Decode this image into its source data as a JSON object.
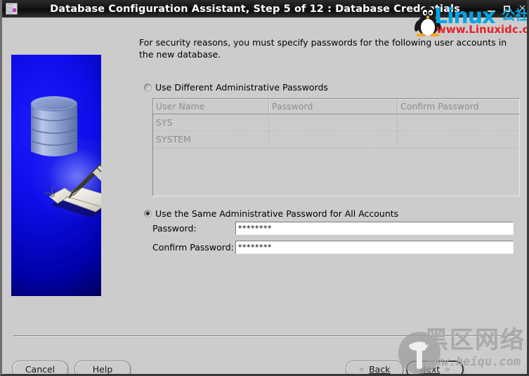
{
  "window": {
    "title": "Database Configuration Assistant, Step 5 of 12 : Database Credentials",
    "icon": "database-assistant-icon",
    "minimize_label": "_",
    "maximize_label": "□",
    "close_label": "×"
  },
  "main": {
    "instructions": "For security reasons, you must specify passwords for the following user accounts in the new database.",
    "option_different": {
      "label": "Use Different Administrative Passwords",
      "selected": false
    },
    "option_same": {
      "label": "Use the Same Administrative Password for All Accounts",
      "selected": true
    },
    "credentials_table": {
      "columns": [
        "User Name",
        "Password",
        "Confirm Password"
      ],
      "rows": [
        {
          "user_name": "SYS",
          "password": "",
          "confirm_password": ""
        },
        {
          "user_name": "SYSTEM",
          "password": "",
          "confirm_password": ""
        }
      ]
    },
    "password_field": {
      "label": "Password:",
      "value": "********"
    },
    "confirm_password_field": {
      "label": "Confirm Password:",
      "value": "********"
    }
  },
  "buttons": {
    "cancel": "Cancel",
    "help": "Help",
    "back": "Back",
    "next": "Next",
    "back_chevron": "«",
    "next_chevron": "»"
  },
  "watermarks": {
    "top": {
      "brand": "Linux",
      "brand_cn": "公社",
      "url": "www.Linuxidc.com"
    },
    "bottom": {
      "brand_cn": "黑区网络",
      "url": "www.heiqu.com"
    }
  },
  "colors": {
    "titlebar": "#141414",
    "panel": "#cccccc",
    "field_bg": "#ffffff",
    "sidebar_blue": "#0d0de8",
    "linux_blue": "#00a6e6",
    "linux_red": "#e8202a",
    "watermark_grey": "#a9a9a9"
  }
}
